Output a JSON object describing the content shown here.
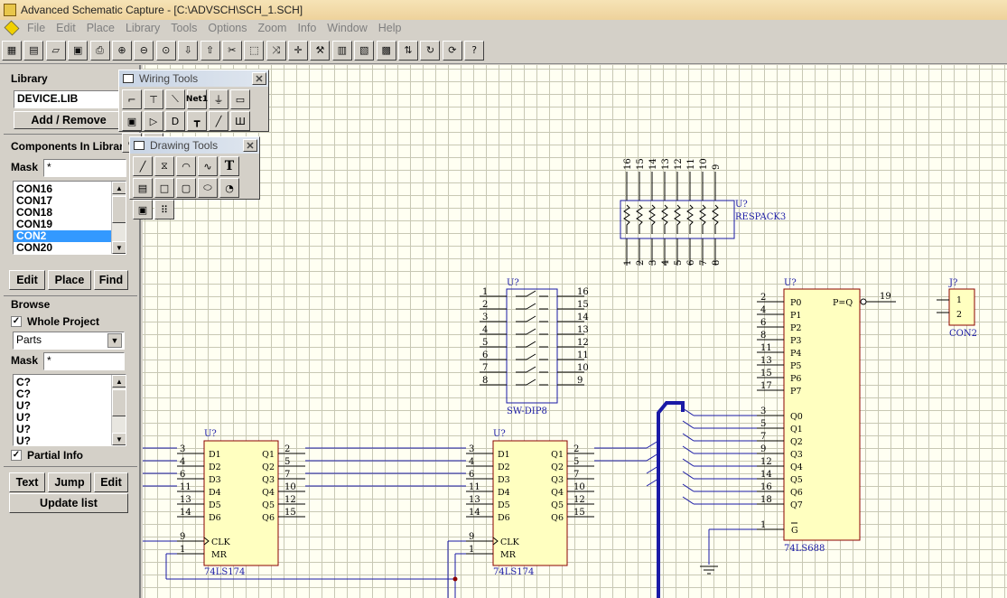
{
  "window": {
    "title": "Advanced Schematic Capture - [C:\\ADVSCH\\SCH_1.SCH]"
  },
  "menu": [
    "File",
    "Edit",
    "Place",
    "Library",
    "Tools",
    "Options",
    "Zoom",
    "Info",
    "Window",
    "Help"
  ],
  "toolbar": {
    "icons": [
      "open-project",
      "library",
      "open-folder",
      "save",
      "print",
      "zoom-in",
      "zoom-out",
      "zoom-area",
      "arrow-down",
      "arrow-up",
      "cut-wire",
      "select-box",
      "move-selection",
      "cross",
      "hammer",
      "ic-book",
      "ic-book-2",
      "pin-array",
      "pin-swap",
      "rotate",
      "refresh"
    ],
    "help_label": "?"
  },
  "library": {
    "heading": "Library",
    "current": "DEVICE.LIB",
    "add_remove": "Add / Remove"
  },
  "components": {
    "heading": "Components In Library",
    "mask_label": "Mask",
    "mask_value": "*",
    "items": [
      "CON16",
      "CON17",
      "CON18",
      "CON19",
      "CON2",
      "CON20"
    ],
    "selected": "CON2",
    "edit": "Edit",
    "place": "Place",
    "find": "Find"
  },
  "browse": {
    "heading": "Browse",
    "whole_project": "Whole Project",
    "whole_project_checked": true,
    "type": "Parts",
    "mask_label": "Mask",
    "mask_value": "*",
    "items": [
      "C?",
      "C?",
      "U?",
      "U?",
      "U?",
      "U?"
    ],
    "partial_info": "Partial Info",
    "partial_info_checked": true,
    "text": "Text",
    "jump": "Jump",
    "edit": "Edit",
    "update": "Update list"
  },
  "wiring_tools": {
    "title": "Wiring Tools",
    "buttons": [
      "wire-icon",
      "bus-icon",
      "bus-entry-icon",
      "net-label-icon",
      "power-port-icon",
      "port-icon",
      "sheet-icon",
      "sheet-entry-icon",
      "part-icon",
      "junction-icon",
      "pencil-icon",
      "directive-icon",
      "no-erc-icon",
      "probe-icon"
    ],
    "net_label": "Net1"
  },
  "drawing_tools": {
    "title": "Drawing Tools",
    "buttons": [
      "line-icon",
      "polygon-icon",
      "arc-icon",
      "bezier-icon",
      "text-icon",
      "text-frame-icon",
      "rectangle-icon",
      "rounded-rect-icon",
      "ellipse-icon",
      "pie-icon",
      "image-icon",
      "array-icon"
    ],
    "text_glyph": "T"
  },
  "schematic": {
    "respack": {
      "designator": "U?",
      "name": "RESPACK3",
      "top_pins": [
        "16",
        "15",
        "14",
        "13",
        "12",
        "11",
        "10",
        "9"
      ],
      "bottom_pins": [
        "1",
        "2",
        "3",
        "4",
        "5",
        "6",
        "7",
        "8"
      ]
    },
    "dip": {
      "designator": "U?",
      "name": "SW-DIP8",
      "left_pins": [
        "1",
        "2",
        "3",
        "4",
        "5",
        "6",
        "7",
        "8"
      ],
      "right_pins": [
        "16",
        "15",
        "14",
        "13",
        "12",
        "11",
        "10",
        "9"
      ]
    },
    "u1": {
      "designator": "U?",
      "name": "74LS174",
      "inputs": [
        "D1",
        "D2",
        "D3",
        "D4",
        "D5",
        "D6"
      ],
      "outputs": [
        "Q1",
        "Q2",
        "Q3",
        "Q4",
        "Q5",
        "Q6"
      ],
      "in_pins": [
        "3",
        "4",
        "6",
        "11",
        "13",
        "14"
      ],
      "out_pins": [
        "2",
        "5",
        "7",
        "10",
        "12",
        "15"
      ],
      "clk": "CLK",
      "mr": "MR",
      "clk_pin": "9",
      "mr_pin": "1"
    },
    "u2": {
      "designator": "U?",
      "name": "74LS174",
      "inputs": [
        "D1",
        "D2",
        "D3",
        "D4",
        "D5",
        "D6"
      ],
      "outputs": [
        "Q1",
        "Q2",
        "Q3",
        "Q4",
        "Q5",
        "Q6"
      ],
      "in_pins": [
        "3",
        "4",
        "6",
        "11",
        "13",
        "14"
      ],
      "out_pins": [
        "2",
        "5",
        "7",
        "10",
        "12",
        "15"
      ],
      "clk": "CLK",
      "mr": "MR",
      "clk_pin": "9",
      "mr_pin": "1"
    },
    "comp": {
      "designator": "U?",
      "name": "74LS688",
      "p_labels": [
        "P0",
        "P1",
        "P2",
        "P3",
        "P4",
        "P5",
        "P6",
        "P7"
      ],
      "p_pins": [
        "2",
        "4",
        "6",
        "8",
        "11",
        "13",
        "15",
        "17"
      ],
      "q_labels": [
        "Q0",
        "Q1",
        "Q2",
        "Q3",
        "Q4",
        "Q5",
        "Q6",
        "Q7"
      ],
      "q_pins": [
        "3",
        "5",
        "7",
        "9",
        "12",
        "14",
        "16",
        "18"
      ],
      "out_label": "P=Q",
      "out_pin": "19",
      "g_label": "G",
      "g_pin": "1"
    },
    "con": {
      "designator": "J?",
      "name": "CON2",
      "pins": [
        "1",
        "2"
      ]
    }
  }
}
